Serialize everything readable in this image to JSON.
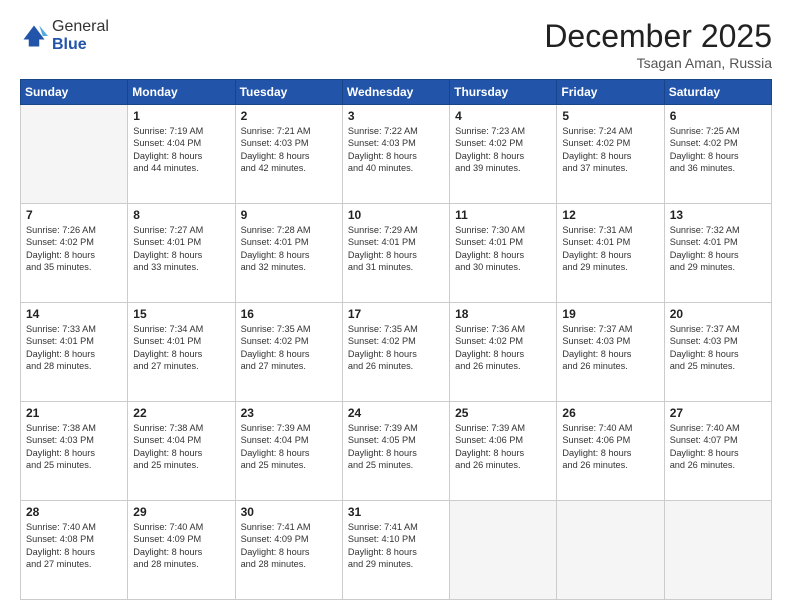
{
  "header": {
    "logo_general": "General",
    "logo_blue": "Blue",
    "month_title": "December 2025",
    "location": "Tsagan Aman, Russia"
  },
  "days_of_week": [
    "Sunday",
    "Monday",
    "Tuesday",
    "Wednesday",
    "Thursday",
    "Friday",
    "Saturday"
  ],
  "weeks": [
    [
      {
        "day": "",
        "lines": []
      },
      {
        "day": "1",
        "lines": [
          "Sunrise: 7:19 AM",
          "Sunset: 4:04 PM",
          "Daylight: 8 hours",
          "and 44 minutes."
        ]
      },
      {
        "day": "2",
        "lines": [
          "Sunrise: 7:21 AM",
          "Sunset: 4:03 PM",
          "Daylight: 8 hours",
          "and 42 minutes."
        ]
      },
      {
        "day": "3",
        "lines": [
          "Sunrise: 7:22 AM",
          "Sunset: 4:03 PM",
          "Daylight: 8 hours",
          "and 40 minutes."
        ]
      },
      {
        "day": "4",
        "lines": [
          "Sunrise: 7:23 AM",
          "Sunset: 4:02 PM",
          "Daylight: 8 hours",
          "and 39 minutes."
        ]
      },
      {
        "day": "5",
        "lines": [
          "Sunrise: 7:24 AM",
          "Sunset: 4:02 PM",
          "Daylight: 8 hours",
          "and 37 minutes."
        ]
      },
      {
        "day": "6",
        "lines": [
          "Sunrise: 7:25 AM",
          "Sunset: 4:02 PM",
          "Daylight: 8 hours",
          "and 36 minutes."
        ]
      }
    ],
    [
      {
        "day": "7",
        "lines": [
          "Sunrise: 7:26 AM",
          "Sunset: 4:02 PM",
          "Daylight: 8 hours",
          "and 35 minutes."
        ]
      },
      {
        "day": "8",
        "lines": [
          "Sunrise: 7:27 AM",
          "Sunset: 4:01 PM",
          "Daylight: 8 hours",
          "and 33 minutes."
        ]
      },
      {
        "day": "9",
        "lines": [
          "Sunrise: 7:28 AM",
          "Sunset: 4:01 PM",
          "Daylight: 8 hours",
          "and 32 minutes."
        ]
      },
      {
        "day": "10",
        "lines": [
          "Sunrise: 7:29 AM",
          "Sunset: 4:01 PM",
          "Daylight: 8 hours",
          "and 31 minutes."
        ]
      },
      {
        "day": "11",
        "lines": [
          "Sunrise: 7:30 AM",
          "Sunset: 4:01 PM",
          "Daylight: 8 hours",
          "and 30 minutes."
        ]
      },
      {
        "day": "12",
        "lines": [
          "Sunrise: 7:31 AM",
          "Sunset: 4:01 PM",
          "Daylight: 8 hours",
          "and 29 minutes."
        ]
      },
      {
        "day": "13",
        "lines": [
          "Sunrise: 7:32 AM",
          "Sunset: 4:01 PM",
          "Daylight: 8 hours",
          "and 29 minutes."
        ]
      }
    ],
    [
      {
        "day": "14",
        "lines": [
          "Sunrise: 7:33 AM",
          "Sunset: 4:01 PM",
          "Daylight: 8 hours",
          "and 28 minutes."
        ]
      },
      {
        "day": "15",
        "lines": [
          "Sunrise: 7:34 AM",
          "Sunset: 4:01 PM",
          "Daylight: 8 hours",
          "and 27 minutes."
        ]
      },
      {
        "day": "16",
        "lines": [
          "Sunrise: 7:35 AM",
          "Sunset: 4:02 PM",
          "Daylight: 8 hours",
          "and 27 minutes."
        ]
      },
      {
        "day": "17",
        "lines": [
          "Sunrise: 7:35 AM",
          "Sunset: 4:02 PM",
          "Daylight: 8 hours",
          "and 26 minutes."
        ]
      },
      {
        "day": "18",
        "lines": [
          "Sunrise: 7:36 AM",
          "Sunset: 4:02 PM",
          "Daylight: 8 hours",
          "and 26 minutes."
        ]
      },
      {
        "day": "19",
        "lines": [
          "Sunrise: 7:37 AM",
          "Sunset: 4:03 PM",
          "Daylight: 8 hours",
          "and 26 minutes."
        ]
      },
      {
        "day": "20",
        "lines": [
          "Sunrise: 7:37 AM",
          "Sunset: 4:03 PM",
          "Daylight: 8 hours",
          "and 25 minutes."
        ]
      }
    ],
    [
      {
        "day": "21",
        "lines": [
          "Sunrise: 7:38 AM",
          "Sunset: 4:03 PM",
          "Daylight: 8 hours",
          "and 25 minutes."
        ]
      },
      {
        "day": "22",
        "lines": [
          "Sunrise: 7:38 AM",
          "Sunset: 4:04 PM",
          "Daylight: 8 hours",
          "and 25 minutes."
        ]
      },
      {
        "day": "23",
        "lines": [
          "Sunrise: 7:39 AM",
          "Sunset: 4:04 PM",
          "Daylight: 8 hours",
          "and 25 minutes."
        ]
      },
      {
        "day": "24",
        "lines": [
          "Sunrise: 7:39 AM",
          "Sunset: 4:05 PM",
          "Daylight: 8 hours",
          "and 25 minutes."
        ]
      },
      {
        "day": "25",
        "lines": [
          "Sunrise: 7:39 AM",
          "Sunset: 4:06 PM",
          "Daylight: 8 hours",
          "and 26 minutes."
        ]
      },
      {
        "day": "26",
        "lines": [
          "Sunrise: 7:40 AM",
          "Sunset: 4:06 PM",
          "Daylight: 8 hours",
          "and 26 minutes."
        ]
      },
      {
        "day": "27",
        "lines": [
          "Sunrise: 7:40 AM",
          "Sunset: 4:07 PM",
          "Daylight: 8 hours",
          "and 26 minutes."
        ]
      }
    ],
    [
      {
        "day": "28",
        "lines": [
          "Sunrise: 7:40 AM",
          "Sunset: 4:08 PM",
          "Daylight: 8 hours",
          "and 27 minutes."
        ]
      },
      {
        "day": "29",
        "lines": [
          "Sunrise: 7:40 AM",
          "Sunset: 4:09 PM",
          "Daylight: 8 hours",
          "and 28 minutes."
        ]
      },
      {
        "day": "30",
        "lines": [
          "Sunrise: 7:41 AM",
          "Sunset: 4:09 PM",
          "Daylight: 8 hours",
          "and 28 minutes."
        ]
      },
      {
        "day": "31",
        "lines": [
          "Sunrise: 7:41 AM",
          "Sunset: 4:10 PM",
          "Daylight: 8 hours",
          "and 29 minutes."
        ]
      },
      {
        "day": "",
        "lines": []
      },
      {
        "day": "",
        "lines": []
      },
      {
        "day": "",
        "lines": []
      }
    ]
  ]
}
